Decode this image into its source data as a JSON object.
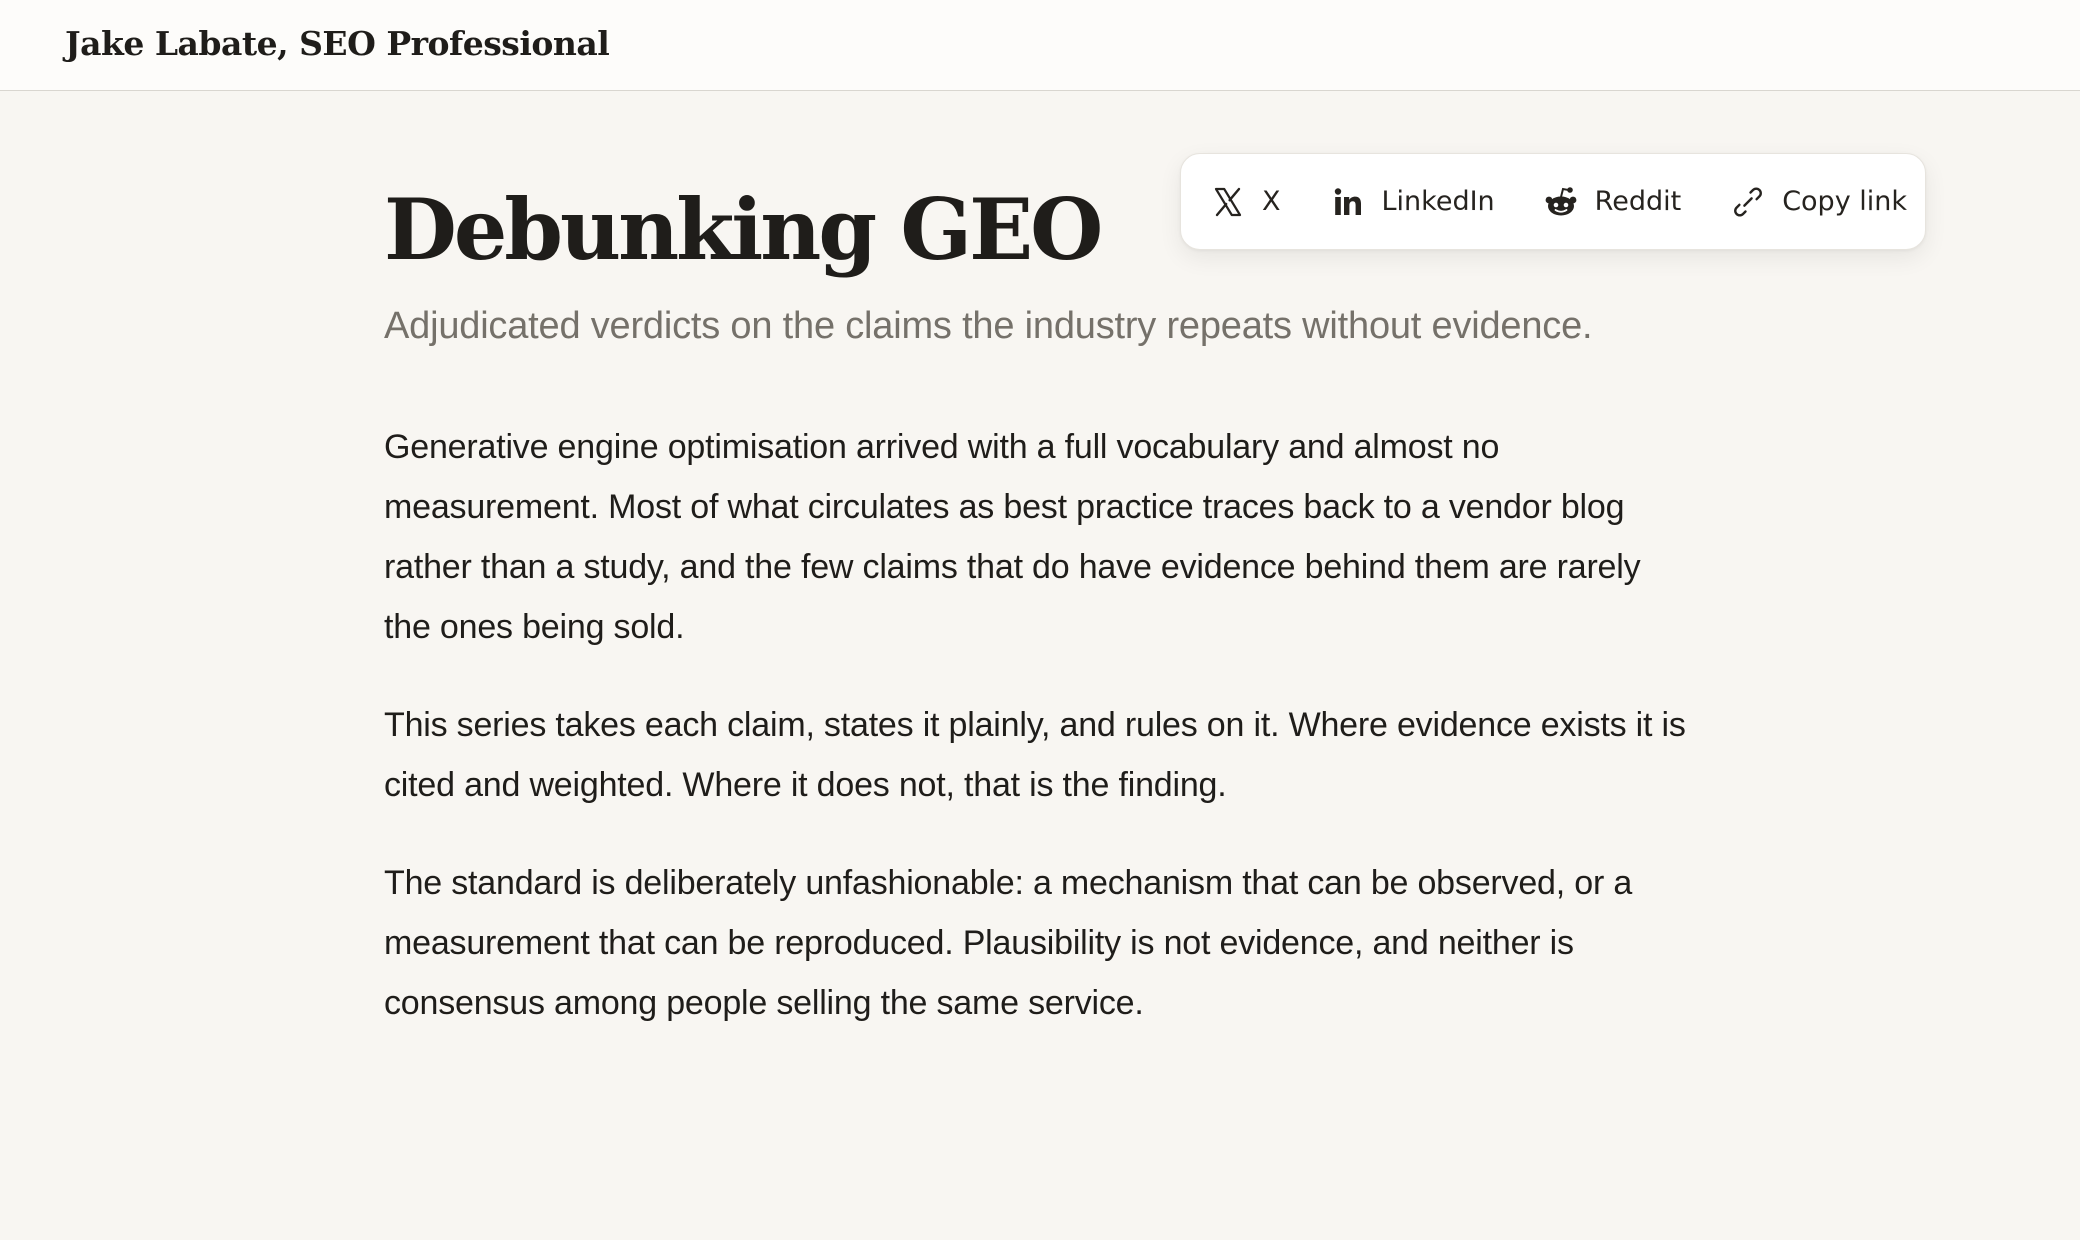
{
  "header": {
    "site_title": "Jake Labate, SEO Professional"
  },
  "article": {
    "title": "Debunking GEO",
    "subtitle": "Adjudicated verdicts on the claims the industry repeats without evidence.",
    "paragraphs": [
      "Generative engine optimisation arrived with a full vocabulary and almost no measurement. Most of what circulates as best practice traces back to a vendor blog rather than a study, and the few claims that do have evidence behind them are rarely the ones being sold.",
      "This series takes each claim, states it plainly, and rules on it. Where evidence exists it is cited and weighted. Where it does not, that is the finding.",
      "The standard is deliberately unfashionable: a mechanism that can be observed, or a measurement that can be reproduced. Plausibility is not evidence, and neither is consensus among people selling the same service."
    ]
  },
  "share": {
    "items": [
      {
        "label": "X",
        "icon": "x-logo-icon"
      },
      {
        "label": "LinkedIn",
        "icon": "linkedin-icon"
      },
      {
        "label": "Reddit",
        "icon": "reddit-icon"
      },
      {
        "label": "Copy link",
        "icon": "link-icon"
      }
    ]
  },
  "colors": {
    "page_background": "#f8f6f2",
    "header_background": "#fdfcfa",
    "text": "#1f1d1a",
    "subtitle": "#75716a"
  }
}
